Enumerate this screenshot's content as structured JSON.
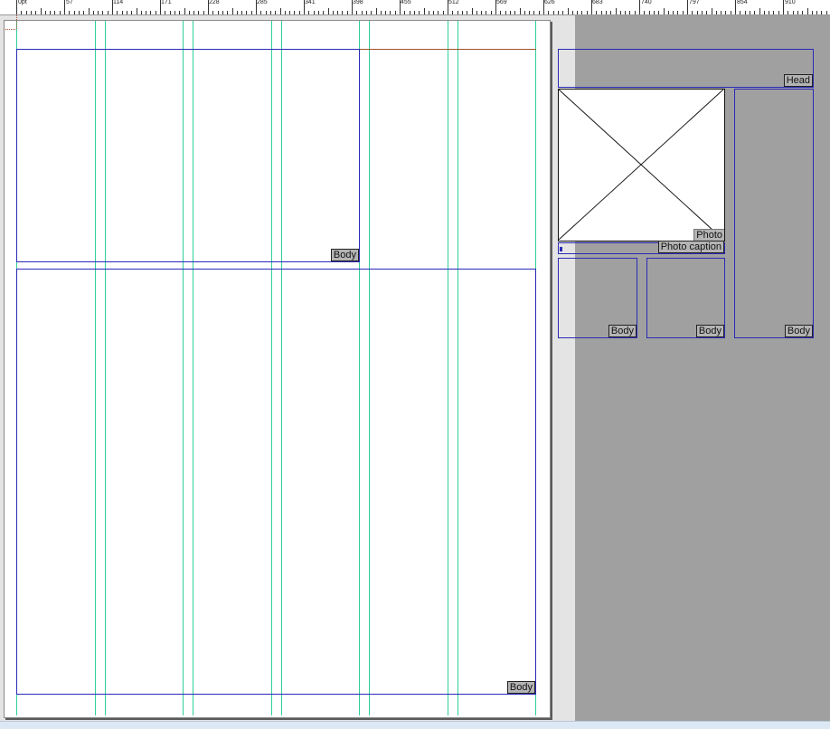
{
  "ruler": {
    "unit": "pt",
    "labels": [
      "0pt",
      "57",
      "114",
      "171",
      "228",
      "285",
      "341",
      "398",
      "455",
      "512",
      "569",
      "626",
      "683",
      "740",
      "797",
      "854",
      "910"
    ]
  },
  "frames": {
    "body_top": "Body",
    "body_main": "Body",
    "head": "Head",
    "photo": "Photo",
    "photo_caption": "Photo caption",
    "body_small_1": "Body",
    "body_small_2": "Body",
    "body_tall": "Body"
  },
  "colors": {
    "frame_border": "#2a2ab8",
    "guide": "#2ecf9a",
    "margin_guide": "#a0522d",
    "pasteboard": "#a0a0a0"
  }
}
